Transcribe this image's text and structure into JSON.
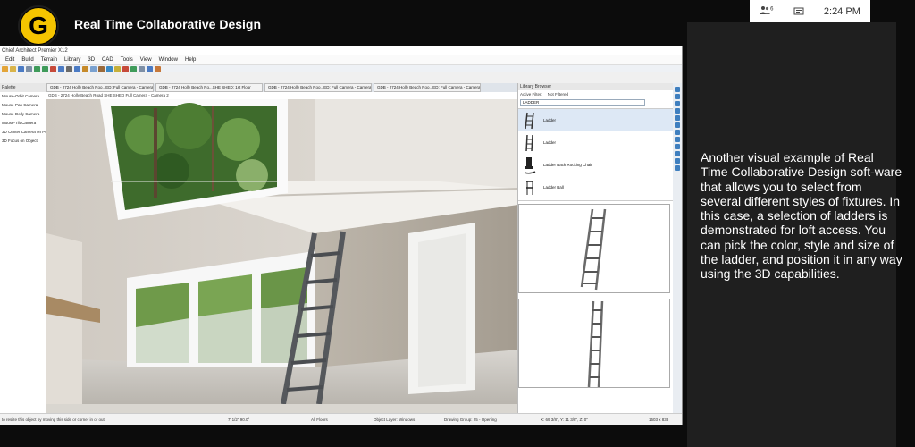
{
  "header": {
    "logo_letter": "G",
    "title": "Real Time Collaborative Design"
  },
  "app": {
    "window_title": "Chief Architect Premier X12",
    "menus": [
      "Edit",
      "Build",
      "Terrain",
      "Library",
      "3D",
      "CAD",
      "Tools",
      "View",
      "Window",
      "Help"
    ],
    "palette": {
      "title": "Palette",
      "items": [
        "Mouse-Orbit Camera",
        "Mouse-Pan Camera",
        "Mouse-Dolly Camera",
        "Mouse-Tilt Camera",
        "3D Center Camera on Point",
        "3D Focus on Object"
      ]
    },
    "tabs": [
      "GDB - 2724 Holly Beach Roo...ED: Full Camera - Camera 1",
      "GDB - 2724 Holly Beach Ro...SHE SHED: 1st Floor",
      "GDB - 2724 Holly Beach Roo...ED: Full Camera - Camera 3",
      "GDB - 2724 Holly Beach Roo...ED: Full Camera - Camera 2"
    ],
    "view_label": "GDB - 2724 Holly Beach Road SHE SHED Full Camera - Camera 2",
    "library": {
      "title": "Library Browser",
      "filter_label": "Active Filter:",
      "filter_value": "Not Filtered",
      "search_value": "LADDER",
      "items": [
        "Ladder",
        "Ladder",
        "Ladder Back Rocking Chair",
        "Ladder Ball"
      ]
    },
    "status": {
      "hint": "to resize this object by moving this side or corner in or out.",
      "angle": "7' 1/2\"   90.0°",
      "floors": "All Floors",
      "layer": "Object Layer: Windows",
      "group": "Drawing Group: 25 - Opening",
      "coords": "X: 69 3/8\", Y: 11 3/8\", Z: 0\"",
      "size": "1503 x 838"
    }
  },
  "system": {
    "notification_count": "6",
    "time": "2:24 PM"
  },
  "caption": "Another visual example of Real Time Collaborative Design soft-ware that allows you to select from several different styles of fixtures. In this case, a selection of ladders is demonstrated for loft access. You can pick the color, style and size of the ladder, and position it in any way using the 3D capabilities.",
  "colors": {
    "logo_yellow": "#f5c400",
    "panel_dark": "#1f1f1f",
    "accent_blue": "#3f7fbf"
  }
}
